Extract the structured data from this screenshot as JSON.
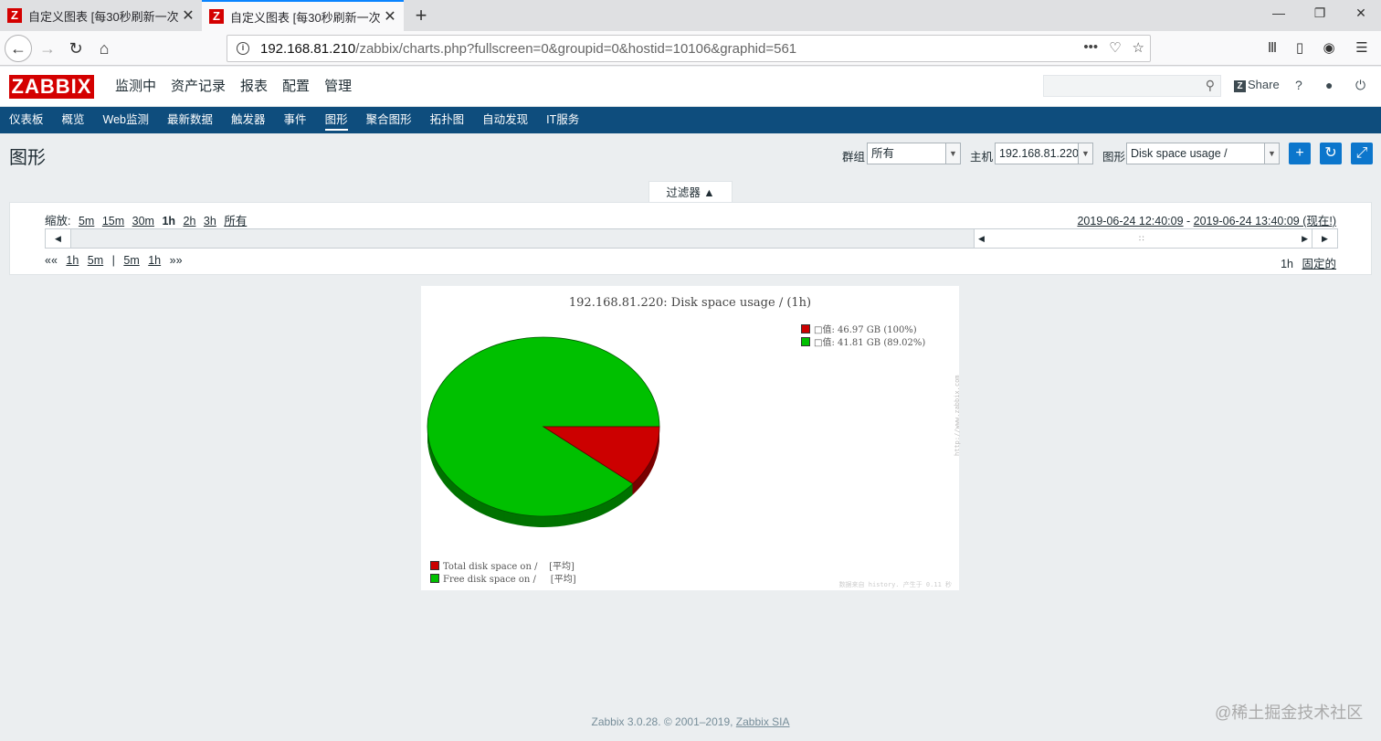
{
  "browser": {
    "tabs": [
      {
        "title": "自定义图表 [每30秒刷新一次]",
        "active": false
      },
      {
        "title": "自定义图表 [每30秒刷新一次]",
        "active": true
      }
    ],
    "url_host": "192.168.81.210",
    "url_path": "/zabbix/charts.php?fullscreen=0&groupid=0&hostid=10106&graphid=561"
  },
  "header": {
    "logo": "ZABBIX",
    "menu": [
      "监测中",
      "资产记录",
      "报表",
      "配置",
      "管理"
    ],
    "share_label": "Share",
    "help": "?"
  },
  "subnav": [
    "仪表板",
    "概览",
    "Web监测",
    "最新数据",
    "触发器",
    "事件",
    "图形",
    "聚合图形",
    "拓扑图",
    "自动发现",
    "IT服务"
  ],
  "page": {
    "title": "图形",
    "group_label": "群组",
    "group_value": "所有",
    "host_label": "主机",
    "host_value": "192.168.81.220",
    "graph_label": "图形",
    "graph_value": "Disk space usage /"
  },
  "filter": {
    "tab_label": "过滤器 ▲",
    "zoom_label": "缩放:",
    "zoom_options": [
      "5m",
      "15m",
      "30m",
      "1h",
      "2h",
      "3h",
      "所有"
    ],
    "zoom_current": "1h",
    "range_from": "2019-06-24 12:40:09",
    "range_sep": " - ",
    "range_to": "2019-06-24 13:40:09 (现在!)",
    "nav_back": "««",
    "nav_left": [
      "1h",
      "5m"
    ],
    "nav_sep": "|",
    "nav_right": [
      "5m",
      "1h"
    ],
    "nav_fwd": "»»",
    "period": "1h",
    "fixed_label": "固定的"
  },
  "graph": {
    "title": "192.168.81.220: Disk space usage / (1h)",
    "legend_top": [
      {
        "text": "□值: 46.97 GB (100%)",
        "color": "#cc0000"
      },
      {
        "text": "□值: 41.81 GB (89.02%)",
        "color": "#00c000"
      }
    ],
    "legend_bottom": [
      {
        "text": "Total disk space on /    [平均]",
        "color": "#cc0000"
      },
      {
        "text": "Free disk space on /     [平均]",
        "color": "#00c000"
      }
    ],
    "side_watermark": "http://www.zabbix.com",
    "footer_note": "数据来自 history.  产生于 0.11 秒"
  },
  "chart_data": {
    "type": "pie",
    "title": "192.168.81.220: Disk space usage / (1h)",
    "slices": [
      {
        "label": "Total disk space on /",
        "value": 46.97,
        "unit": "GB",
        "color": "#cc0000"
      },
      {
        "label": "Free disk space on /",
        "value": 41.81,
        "unit": "GB",
        "percent": 89.02,
        "color": "#00c000"
      }
    ]
  },
  "footer": {
    "text": "Zabbix 3.0.28. © 2001–2019, ",
    "link": "Zabbix SIA"
  },
  "watermark": "@稀土掘金技术社区"
}
